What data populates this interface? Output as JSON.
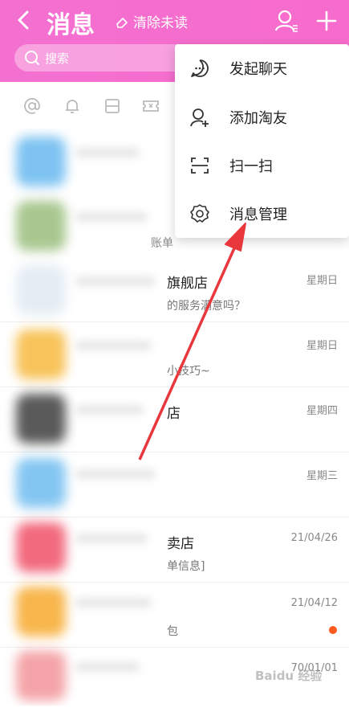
{
  "header": {
    "title": "消息",
    "clear_label": "清除未读"
  },
  "search": {
    "placeholder": "搜索"
  },
  "quick_icons": [
    "at-icon",
    "bell-icon",
    "box-icon",
    "ticket-icon"
  ],
  "menu": {
    "items": [
      {
        "label": "发起聊天",
        "icon": "chat-bubble-icon"
      },
      {
        "label": "添加淘友",
        "icon": "add-friend-icon"
      },
      {
        "label": "扫一扫",
        "icon": "scan-icon"
      },
      {
        "label": "消息管理",
        "icon": "gear-icon"
      }
    ]
  },
  "conversations": [
    {
      "name": "旗舰店",
      "preview": "的服务满意吗？",
      "time": "星期日"
    },
    {
      "name": "",
      "preview": "小技巧~",
      "time": "星期日"
    },
    {
      "name": "店",
      "preview": "",
      "time": "星期四"
    },
    {
      "name": "",
      "preview": "",
      "time": "星期三"
    },
    {
      "name": "卖店",
      "preview": "单信息]",
      "time": "21/04/26"
    },
    {
      "name": "",
      "preview": "包",
      "time": "21/04/12"
    },
    {
      "name": "",
      "preview": "",
      "time": "70/01/01"
    }
  ],
  "partial_text": "账单",
  "watermark": "Baidu 经验",
  "colors": {
    "header": "#f470d0",
    "arrow": "#e8383d",
    "unread": "#ff5a1f"
  }
}
